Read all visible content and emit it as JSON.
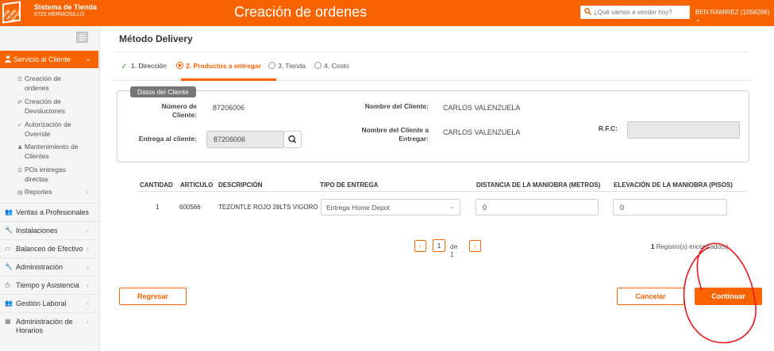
{
  "header": {
    "logo_text": "THE HOME DEPOT",
    "system_title": "Sistema de Tienda",
    "store": "8720 HERMOSILLO",
    "page_title": "Creación de ordenes",
    "search_placeholder": "¿Qué vamos a vender hoy?",
    "user": "BEN RAMIREZ (1058286)",
    "brand_color": "#f96302"
  },
  "sidebar": {
    "active_section": "Servicio al Cliente",
    "sub_items": [
      {
        "label": "Creación de",
        "label2": "ordenes",
        "icon": "list-icon"
      },
      {
        "label": "Creación de",
        "label2": "Devoluciones",
        "icon": "return-icon"
      },
      {
        "label": "Autorización de",
        "label2": "Override",
        "icon": "check-icon"
      },
      {
        "label": "Mantenimiento de",
        "label2": "Clientes",
        "icon": "user-icon"
      },
      {
        "label": "POs entregas",
        "label2": "directas",
        "icon": "list-icon"
      },
      {
        "label": "Reportes",
        "label2": "",
        "icon": "report-icon"
      }
    ],
    "items": [
      {
        "label": "Ventas a Profesionales",
        "icon": "users-icon"
      },
      {
        "label": "Instalaciones",
        "icon": "wrench-icon"
      },
      {
        "label": "Balanceo de Efectivo",
        "icon": "cash-icon"
      },
      {
        "label": "Administración",
        "icon": "wrench-icon"
      },
      {
        "label": "Tiempo y Asistencia",
        "icon": "clock-icon"
      },
      {
        "label": "Gestión Laboral",
        "icon": "team-icon"
      },
      {
        "label": "Administración de",
        "label2": "Horarios",
        "icon": "calendar-icon"
      }
    ]
  },
  "main": {
    "title": "Método Delivery",
    "steps": [
      {
        "label": "1. Dirección",
        "state": "done"
      },
      {
        "label": "2. Productos a entregar",
        "state": "active"
      },
      {
        "label": "3. Tienda",
        "state": "pending"
      },
      {
        "label": "4. Costo",
        "state": "pending"
      }
    ],
    "client_panel": {
      "tag": "Datos del Cliente",
      "numero_label": "Número de",
      "numero_label2": "Cliente:",
      "numero_value": "87206006",
      "nombre_label": "Nombre del Cliente:",
      "nombre_value": "CARLOS VALENZUELA",
      "entrega_label": "Entrega al cliente:",
      "entrega_value": "87206006",
      "nombre_entregar_label": "Nombre del Cliente a",
      "nombre_entregar_label2": "Entregar:",
      "nombre_entregar_value": "CARLOS VALENZUELA",
      "rfc_label": "R.F.C:",
      "rfc_value": ""
    },
    "table": {
      "headers": [
        "CANTIDAD",
        "ARTICULO",
        "DESCRIPCIÓN",
        "TIPO DE ENTREGA",
        "DISTANCIA DE LA MANIOBRA (METROS)",
        "ELEVACIÓN DE LA MANIOBRA (PISOS)"
      ],
      "rows": [
        {
          "cantidad": "1",
          "articulo": "600566",
          "descripcion": "TEZONTLE ROJO 28LTS VIGORO",
          "tipo": "Entrega Home Depot",
          "distancia": "0",
          "elevacion": "0"
        }
      ]
    },
    "pager": {
      "prev": "‹",
      "page": "1",
      "of": "de 1",
      "next": "›"
    },
    "records": {
      "count": "1",
      "text": "Registro(s) encontrado(s)"
    },
    "buttons": {
      "back": "Regresar",
      "cancel": "Cancelar",
      "continue": "Continuar"
    }
  }
}
